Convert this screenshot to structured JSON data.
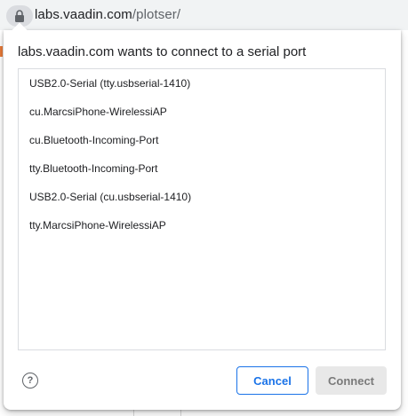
{
  "address_bar": {
    "icon": "lock-icon",
    "host": "labs.vaadin.com",
    "path": "/plotser/"
  },
  "dialog": {
    "title": "labs.vaadin.com wants to connect to a serial port",
    "ports": [
      "USB2.0-Serial (tty.usbserial-1410)",
      "cu.MarcsiPhone-WirelessiAP",
      "cu.Bluetooth-Incoming-Port",
      "tty.Bluetooth-Incoming-Port",
      "USB2.0-Serial (cu.usbserial-1410)",
      "tty.MarcsiPhone-WirelessiAP"
    ],
    "help_icon": "help-icon",
    "help_glyph": "?",
    "cancel_label": "Cancel",
    "connect_label": "Connect"
  },
  "colors": {
    "accent": "#1a73e8",
    "disabled_bg": "#e8e8e8",
    "disabled_text": "#7a7a7a"
  }
}
